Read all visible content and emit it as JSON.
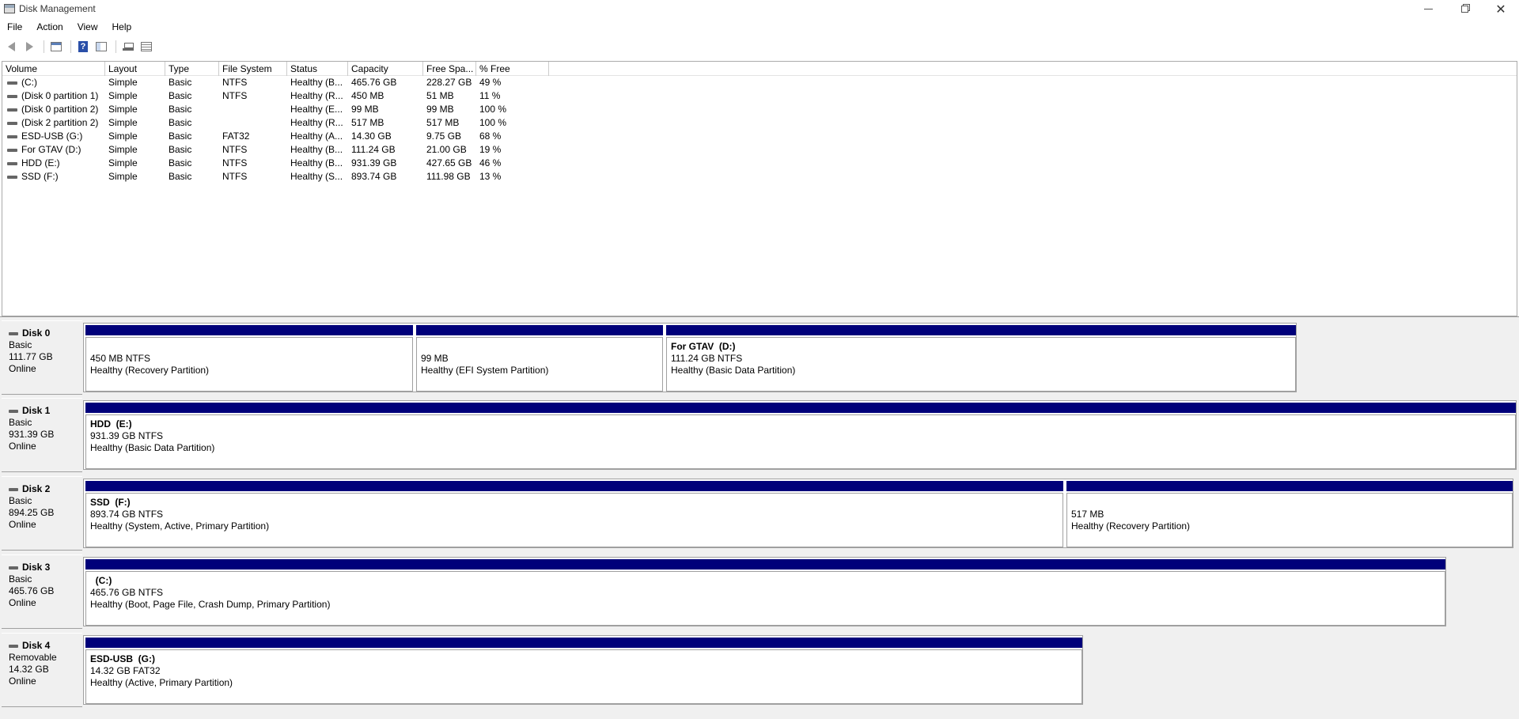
{
  "window": {
    "title": "Disk Management"
  },
  "menu": [
    {
      "label": "File"
    },
    {
      "label": "Action"
    },
    {
      "label": "View"
    },
    {
      "label": "Help"
    }
  ],
  "toolbar": {
    "buttons": [
      "back-icon",
      "forward-icon",
      "console-tree-icon",
      "help-icon",
      "properties-icon",
      "connect-disk-icon",
      "volume-list-icon"
    ],
    "help_glyph": "?"
  },
  "volume_list": {
    "columns": [
      "Volume",
      "Layout",
      "Type",
      "File System",
      "Status",
      "Capacity",
      "Free Spa...",
      "% Free"
    ],
    "rows": [
      {
        "volume": "(C:)",
        "layout": "Simple",
        "type": "Basic",
        "fs": "NTFS",
        "status": "Healthy (B...",
        "capacity": "465.76 GB",
        "free": "228.27 GB",
        "pct": "49 %"
      },
      {
        "volume": "(Disk 0 partition 1)",
        "layout": "Simple",
        "type": "Basic",
        "fs": "NTFS",
        "status": "Healthy (R...",
        "capacity": "450 MB",
        "free": "51 MB",
        "pct": "11 %"
      },
      {
        "volume": "(Disk 0 partition 2)",
        "layout": "Simple",
        "type": "Basic",
        "fs": "",
        "status": "Healthy (E...",
        "capacity": "99 MB",
        "free": "99 MB",
        "pct": "100 %"
      },
      {
        "volume": "(Disk 2 partition 2)",
        "layout": "Simple",
        "type": "Basic",
        "fs": "",
        "status": "Healthy (R...",
        "capacity": "517 MB",
        "free": "517 MB",
        "pct": "100 %"
      },
      {
        "volume": "ESD-USB (G:)",
        "layout": "Simple",
        "type": "Basic",
        "fs": "FAT32",
        "status": "Healthy (A...",
        "capacity": "14.30 GB",
        "free": "9.75 GB",
        "pct": "68 %"
      },
      {
        "volume": "For GTAV (D:)",
        "layout": "Simple",
        "type": "Basic",
        "fs": "NTFS",
        "status": "Healthy (B...",
        "capacity": "111.24 GB",
        "free": "21.00 GB",
        "pct": "19 %"
      },
      {
        "volume": "HDD (E:)",
        "layout": "Simple",
        "type": "Basic",
        "fs": "NTFS",
        "status": "Healthy (B...",
        "capacity": "931.39 GB",
        "free": "427.65 GB",
        "pct": "46 %"
      },
      {
        "volume": "SSD (F:)",
        "layout": "Simple",
        "type": "Basic",
        "fs": "NTFS",
        "status": "Healthy (S...",
        "capacity": "893.74 GB",
        "free": "111.98 GB",
        "pct": "13 %"
      }
    ]
  },
  "disks": [
    {
      "name": "Disk 0",
      "kind": "Basic",
      "size": "111.77 GB",
      "state": "Online",
      "partitions": [
        {
          "name": "",
          "size_fs": "450 MB NTFS",
          "status": "Healthy (Recovery Partition)"
        },
        {
          "name": "",
          "size_fs": "99 MB",
          "status": "Healthy (EFI System Partition)"
        },
        {
          "name": "For GTAV  (D:)",
          "size_fs": "111.24 GB NTFS",
          "status": "Healthy (Basic Data Partition)"
        }
      ]
    },
    {
      "name": "Disk 1",
      "kind": "Basic",
      "size": "931.39 GB",
      "state": "Online",
      "partitions": [
        {
          "name": "HDD  (E:)",
          "size_fs": "931.39 GB NTFS",
          "status": "Healthy (Basic Data Partition)"
        }
      ]
    },
    {
      "name": "Disk 2",
      "kind": "Basic",
      "size": "894.25 GB",
      "state": "Online",
      "partitions": [
        {
          "name": "SSD  (F:)",
          "size_fs": "893.74 GB NTFS",
          "status": "Healthy (System, Active, Primary Partition)"
        },
        {
          "name": "",
          "size_fs": "517 MB",
          "status": "Healthy (Recovery Partition)"
        }
      ]
    },
    {
      "name": "Disk 3",
      "kind": "Basic",
      "size": "465.76 GB",
      "state": "Online",
      "partitions": [
        {
          "name": "  (C:)",
          "size_fs": "465.76 GB NTFS",
          "status": "Healthy (Boot, Page File, Crash Dump, Primary Partition)"
        }
      ]
    },
    {
      "name": "Disk 4",
      "kind": "Removable",
      "size": "14.32 GB",
      "state": "Online",
      "partitions": [
        {
          "name": "ESD-USB  (G:)",
          "size_fs": "14.32 GB FAT32",
          "status": "Healthy (Active, Primary Partition)"
        }
      ]
    }
  ],
  "colors": {
    "partition_bar": "#00007a",
    "pane_background": "#f0f0f0"
  }
}
